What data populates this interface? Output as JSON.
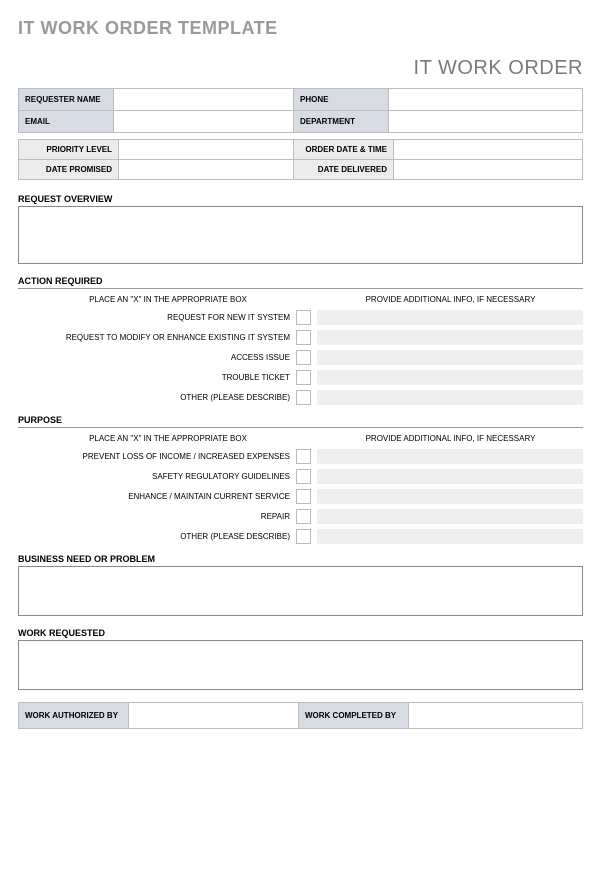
{
  "title": "IT WORK ORDER TEMPLATE",
  "subtitle": "IT WORK ORDER",
  "info": {
    "requester_name_label": "REQUESTER NAME",
    "phone_label": "PHONE",
    "email_label": "EMAIL",
    "department_label": "DEPARTMENT",
    "requester_name": "",
    "phone": "",
    "email": "",
    "department": ""
  },
  "info2": {
    "priority_label": "PRIORITY LEVEL",
    "order_date_label": "ORDER DATE & TIME",
    "date_promised_label": "DATE PROMISED",
    "date_delivered_label": "DATE DELIVERED",
    "priority": "",
    "order_date": "",
    "date_promised": "",
    "date_delivered": ""
  },
  "sections": {
    "request_overview": "REQUEST OVERVIEW",
    "action_required": "ACTION REQUIRED",
    "purpose": "PURPOSE",
    "business_need": "BUSINESS NEED OR PROBLEM",
    "work_requested": "WORK REQUESTED"
  },
  "instructions": {
    "left": "PLACE AN \"X\" IN THE APPROPRIATE BOX",
    "right": "PROVIDE ADDITIONAL INFO, IF NECESSARY"
  },
  "action_items": [
    "REQUEST FOR NEW IT SYSTEM",
    "REQUEST TO MODIFY OR ENHANCE EXISTING IT SYSTEM",
    "ACCESS ISSUE",
    "TROUBLE TICKET",
    "OTHER (PLEASE DESCRIBE)"
  ],
  "purpose_items": [
    "PREVENT LOSS OF INCOME / INCREASED EXPENSES",
    "SAFETY REGULATORY GUIDELINES",
    "ENHANCE / MAINTAIN CURRENT SERVICE",
    "REPAIR",
    "OTHER (PLEASE DESCRIBE)"
  ],
  "footer": {
    "authorized_label": "WORK AUTHORIZED BY",
    "completed_label": "WORK COMPLETED BY",
    "authorized": "",
    "completed": ""
  }
}
